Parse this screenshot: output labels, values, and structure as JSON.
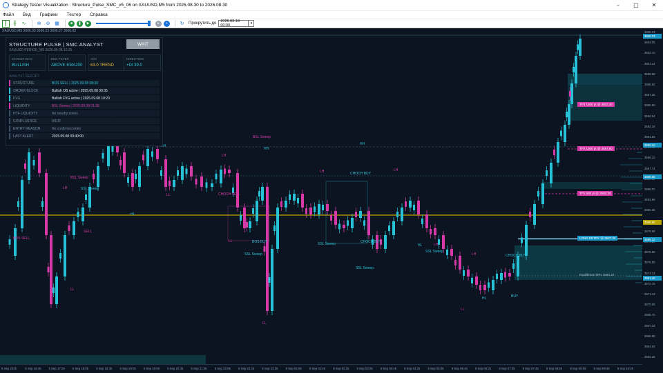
{
  "window": {
    "title": "Strategy Tester Visualization : Structure_Pulse_SMC_v5_06 on XAUUSD,M5 from 2025.08.30 to 2026.08.30",
    "minimize_glyph": "–",
    "maximize_glyph": "□",
    "close_glyph": "✕"
  },
  "menu": [
    "Файл",
    "Вид",
    "Графики",
    "Тестер",
    "Справка"
  ],
  "toolbar": {
    "skip_label": "Прокрутить до",
    "skip_date": "2026.03.18 00:00",
    "speed_fraction": 0.96
  },
  "chart": {
    "header": "XAUUSD,M5  3606.33 3606.23 3606.27 3606.02",
    "price_labels": [
      "3606.33",
      "3604.05",
      "3602.70",
      "3601.34",
      "3599.98",
      "3598.62",
      "3597.26",
      "3595.90",
      "3594.54",
      "3593.18",
      "3591.82",
      "3590.46",
      "3589.10",
      "3587.74",
      "3586.38",
      "3585.02",
      "3583.66",
      "3582.30",
      "3580.94",
      "3579.58",
      "3578.22",
      "3576.86",
      "3575.50",
      "3574.14",
      "3572.78",
      "3571.42",
      "3570.06",
      "3568.70",
      "3567.34",
      "3565.98",
      "3564.62",
      "3563.26"
    ],
    "current_price": "3606.33",
    "price_tags": [
      {
        "text": "3592.12",
        "color": "#1a98c8"
      },
      {
        "text": "3590.06",
        "color": "#1a98c8"
      },
      {
        "text": "3589.85",
        "color": "#b8a200"
      },
      {
        "text": "3585.12",
        "color": "#1a98c8"
      },
      {
        "text": "3581.40",
        "color": "#1a98c8"
      }
    ],
    "time_labels": [
      "5 Sep 2025",
      "5 Sep 16:45",
      "5 Sep 17:25",
      "5 Sep 18:05",
      "5 Sep 18:45",
      "5 Sep 19:25",
      "5 Sep 20:05",
      "5 Sep 20:45",
      "5 Sep 21:25",
      "5 Sep 22:05",
      "5 Sep 22:45",
      "5 Sep 23:25",
      "8 Sep 01:05",
      "8 Sep 01:45",
      "8 Sep 02:25",
      "8 Sep 03:05",
      "8 Sep 03:45",
      "8 Sep 04:25",
      "8 Sep 05:05",
      "8 Sep 05:45",
      "8 Sep 06:25",
      "8 Sep 07:05",
      "8 Sep 07:45",
      "8 Sep 08:25",
      "8 Sep 09:05",
      "8 Sep 09:45",
      "8 Sep 10:25"
    ]
  },
  "panel": {
    "title": "STRUCTURE PULSE  |  SMC ANALYST",
    "subtitle": "XAUUSD  PERIOD_M5  2025.09.08 10:25",
    "action_button": "WAIT",
    "cards": [
      {
        "label": "MARKET BIAS",
        "value": "BULLISH",
        "color": "#2ec4d6"
      },
      {
        "label": "EMA FILTER",
        "value": "ABOVE EMA200",
        "color": "#2ec4d6"
      },
      {
        "label": "ADX",
        "value": "63.0 TREND",
        "color": "#e8b53a"
      },
      {
        "label": "DIRECTION",
        "value": "+DI 39.0",
        "color": "#2ec4d6"
      }
    ],
    "report_label": "ANALYST REPORT",
    "rows": [
      {
        "key": "STRUCTURE",
        "value": "BOS SELL | 2025.09.08 08:30",
        "bar": "#d63aa8",
        "color": "#2ec4d6"
      },
      {
        "key": "ORDER BLOCK",
        "value": "Bullish OB active | 2025.09.08 09:35",
        "bar": "#2ec4d6",
        "color": "#e6eef5"
      },
      {
        "key": "FVG",
        "value": "Bullish FVG active | 2025.09.08 10:20",
        "bar": "#2ec4d6",
        "color": "#e6eef5"
      },
      {
        "key": "LIQUIDITY",
        "value": "BSL Sweep | 2025.09.08 01:35",
        "bar": "#d63aa8",
        "color": "#d63aa8"
      },
      {
        "key": "HTF LIQUIDITY",
        "value": "No nearby zones",
        "bar": "#3c5064",
        "color": "#7a8c9c"
      },
      {
        "key": "CONFLUENCE",
        "value": "0/100",
        "bar": "#3c5064",
        "color": "#7a8c9c"
      },
      {
        "key": "ENTRY REASON",
        "value": "No confirmed entry",
        "bar": "#3c5064",
        "color": "#7a8c9c"
      },
      {
        "key": "LAST ALERT",
        "value": "2025.09.08 09:40:00",
        "bar": "#3c5064",
        "color": "#e6eef5"
      }
    ]
  },
  "annotations": [
    {
      "text": "BSL Sweep",
      "color": "#d63aa8"
    },
    {
      "text": "HH",
      "color": "#2ec4d6"
    },
    {
      "text": "LH",
      "color": "#d63aa8"
    },
    {
      "text": "SSL Sweep",
      "color": "#2ec4d6"
    },
    {
      "text": "CHOCH BUY",
      "color": "#2ec4d6"
    },
    {
      "text": "CHOCH SELL",
      "color": "#d63aa8"
    },
    {
      "text": "BOS SELL",
      "color": "#d63aa8"
    },
    {
      "text": "BOS BUY",
      "color": "#2ec4d6"
    },
    {
      "text": "HL",
      "color": "#2ec4d6"
    },
    {
      "text": "LL",
      "color": "#d63aa8"
    },
    {
      "text": "BUY",
      "color": "#2ec4d6"
    },
    {
      "text": "SELL",
      "color": "#d63aa8"
    }
  ],
  "zones": {
    "tp3": "TP3  1500 pt  @ 3603.30",
    "tp2": "TP2  1000 pt  @ 3597.80",
    "tp1": "TP1  500 pt  @ 3592.30",
    "entry": "LONG ENTRY  @ 3587.30",
    "equilibrium": "Equilibrium 50%  3583.18"
  },
  "colors": {
    "background": "#0b1420",
    "bull": "#27c2d6",
    "bear": "#d63aa8",
    "level_line": "#c8a800"
  }
}
